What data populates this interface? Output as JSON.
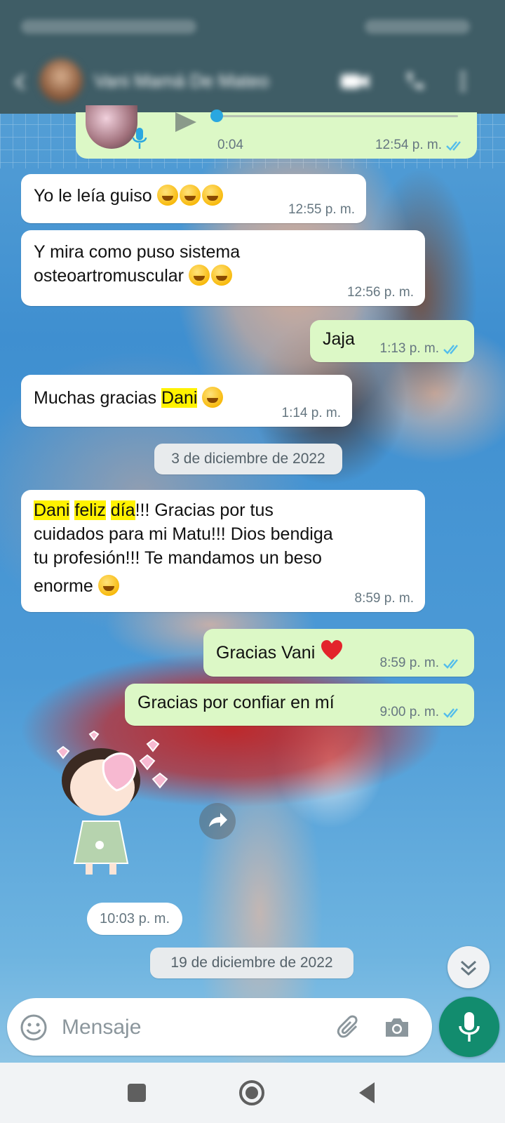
{
  "header": {
    "contact_name": "Vani Mamá De Mateo"
  },
  "voice_note": {
    "duration": "0:04",
    "time": "12:54 p. m."
  },
  "messages": [
    {
      "text": "Yo le leía guiso",
      "time": "12:55 p. m."
    },
    {
      "line1": "Y mira como puso sistema",
      "line2": "osteoartromuscular",
      "time": "12:56 p. m."
    },
    {
      "text": "Jaja",
      "time": "1:13 p. m."
    },
    {
      "pre": "Muchas gracias ",
      "hl": "Dani",
      "time": "1:14 p. m."
    },
    {
      "hl1": "Dani",
      "hl2": "feliz",
      "hl3": "día",
      "rest1": "!!! Gracias por tus",
      "line2": "cuidados para mi Matu!!! Dios bendiga",
      "line3": "tu profesión!!! Te mandamos un beso",
      "line4": "enorme",
      "time": "8:59 p. m."
    },
    {
      "text": "Gracias Vani",
      "time": "8:59 p. m."
    },
    {
      "text": "Gracias por confiar en mí",
      "time": "9:00 p. m."
    }
  ],
  "dates": [
    "3 de diciembre de 2022",
    "19 de diciembre de 2022"
  ],
  "sticker_time": "10:03 p. m.",
  "composer": {
    "placeholder": "Mensaje"
  },
  "colors": {
    "header": "#3f5d66",
    "outgoing_bubble": "#dcf8c6",
    "incoming_bubble": "#ffffff",
    "accent_green": "#128c6e",
    "read_ticks": "#53bdeb",
    "highlight": "#fff200"
  }
}
